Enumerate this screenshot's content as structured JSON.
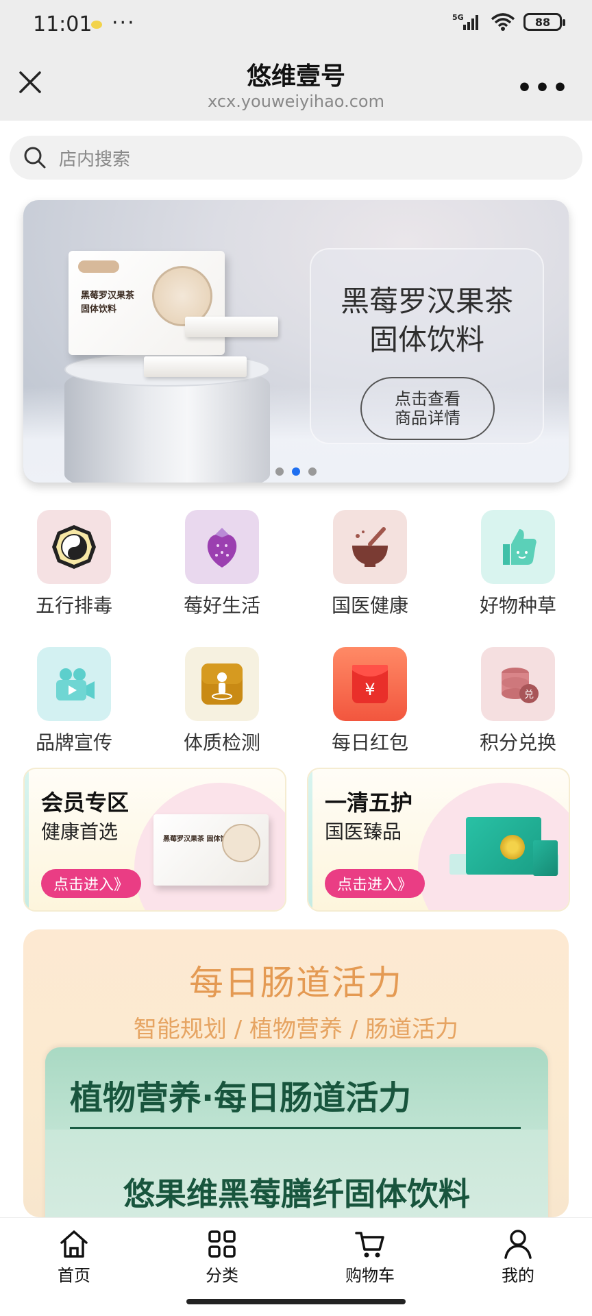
{
  "status_bar": {
    "time": "11:01",
    "network": "5G",
    "battery": "88"
  },
  "nav": {
    "title": "悠维壹号",
    "subtitle": "xcx.youweiyihao.com"
  },
  "search": {
    "placeholder": "店内搜索"
  },
  "banner": {
    "title_line1": "黑莓罗汉果茶",
    "title_line2": "固体饮料",
    "button_line1": "点击查看",
    "button_line2": "商品详情",
    "product_name_line1": "黑莓罗汉果茶",
    "product_name_line2": "固体饮料",
    "page_count": 3,
    "active_page": 2
  },
  "categories": [
    {
      "label": "五行排毒",
      "icon": "yin-yang-icon",
      "bg": "#f5e1e3"
    },
    {
      "label": "莓好生活",
      "icon": "strawberry-icon",
      "bg": "#e9d8ee"
    },
    {
      "label": "国医健康",
      "icon": "mortar-icon",
      "bg": "#f4e1de"
    },
    {
      "label": "好物种草",
      "icon": "thumbs-up-icon",
      "bg": "#d9f4ef"
    },
    {
      "label": "品牌宣传",
      "icon": "video-camera-icon",
      "bg": "#d3f1f2"
    },
    {
      "label": "体质检测",
      "icon": "person-scan-icon",
      "bg": "#f6f1e0"
    },
    {
      "label": "每日红包",
      "icon": "red-packet-icon",
      "bg": "#ff7a5a"
    },
    {
      "label": "积分兑换",
      "icon": "coins-exchange-icon",
      "bg": "#f5dfe0"
    }
  ],
  "promos": [
    {
      "title": "会员专区",
      "subtitle": "健康首选",
      "button": "点击进入》",
      "product_text": "黑莓罗汉果茶 固体饮料"
    },
    {
      "title": "一清五护",
      "subtitle": "国医臻品",
      "button": "点击进入》"
    }
  ],
  "feature": {
    "title": "每日肠道活力",
    "subtitle": "智能规划 / 植物营养 / 肠道活力",
    "card_title": "植物营养·每日肠道活力",
    "card_subtitle": "悠果维黑莓膳纤固体饮料"
  },
  "tabs": [
    {
      "label": "首页",
      "icon": "home-icon"
    },
    {
      "label": "分类",
      "icon": "grid-icon"
    },
    {
      "label": "购物车",
      "icon": "cart-icon"
    },
    {
      "label": "我的",
      "icon": "user-icon"
    }
  ],
  "colors": {
    "accent_blue": "#1f6ff0",
    "promo_button": "#ea3d84",
    "feature_orange": "#e49a53",
    "feature_green": "#18553d"
  }
}
